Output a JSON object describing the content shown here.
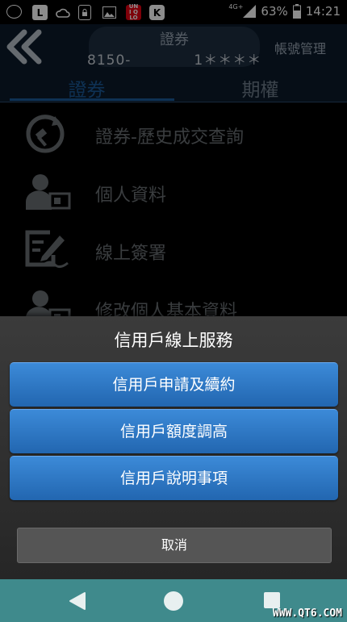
{
  "status_bar": {
    "network": "4G+",
    "battery": "63%",
    "time": "14:21",
    "notification_icons": [
      "game-icon",
      "line-icon",
      "cloud-icon",
      "lock-icon",
      "image-icon",
      "uniqlo-icon",
      "k-icon"
    ],
    "uniqlo_text": "UNI QLO",
    "line_text": "L",
    "k_text": "K"
  },
  "header": {
    "title": "證券",
    "account_prefix": "8150-",
    "account_suffix": "1＊＊＊＊",
    "manage_label": "帳號管理"
  },
  "tabs": [
    {
      "label": "證券",
      "active": true
    },
    {
      "label": "期權",
      "active": false
    }
  ],
  "menu": [
    {
      "label": "證券-歷史成交查詢",
      "icon": "history-trade-icon"
    },
    {
      "label": "個人資料",
      "icon": "profile-icon"
    },
    {
      "label": "線上簽署",
      "icon": "sign-icon"
    },
    {
      "label": "修改個人基本資料",
      "icon": "edit-profile-icon"
    }
  ],
  "dialog": {
    "title": "信用戶線上服務",
    "buttons": [
      {
        "label": "信用戶申請及續約"
      },
      {
        "label": "信用戶額度調高"
      },
      {
        "label": "信用戶說明事項"
      }
    ],
    "cancel_label": "取消"
  },
  "watermark": "WWW.QT6.COM"
}
